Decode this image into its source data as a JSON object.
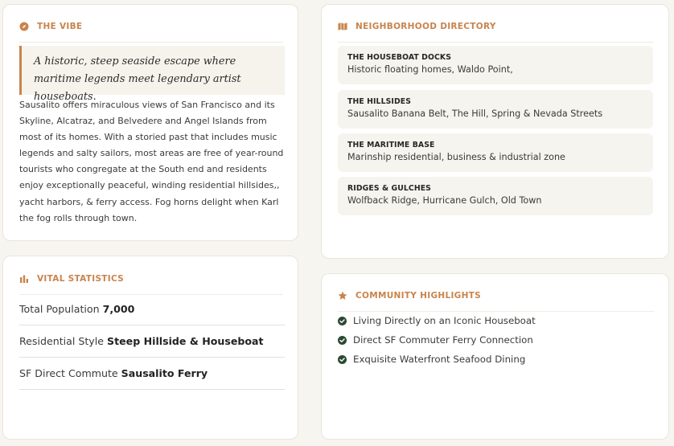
{
  "vibe": {
    "title": "The Vibe",
    "quote": "A historic, steep seaside escape where maritime legends meet legendary artist houseboats.",
    "body": "Sausalito offers miraculous views of San Francisco and its Skyline, Alcatraz, and Belvedere and Angel Islands from most of its homes. With a storied past that includes music legends and salty sailors, most areas are free of year-round tourists who congregate at the South end and residents enjoy exceptionally peaceful, winding residential hillsides,, yacht harbors, & ferry access. Fog horns delight when Karl the fog rolls through town."
  },
  "stats": {
    "title": "Vital Statistics",
    "items": [
      {
        "label": "Total Population",
        "value": "7,000"
      },
      {
        "label": "Residential Style",
        "value": "Steep Hillside & Houseboat"
      },
      {
        "label": "SF Direct Commute",
        "value": "Sausalito Ferry"
      }
    ]
  },
  "directory": {
    "title": "Neighborhood Directory",
    "items": [
      {
        "name": "THE HOUSEBOAT DOCKS",
        "desc": "Historic floating homes, Waldo Point,"
      },
      {
        "name": "THE HILLSIDES",
        "desc": "Sausalito Banana Belt, The Hill, Spring & Nevada Streets"
      },
      {
        "name": "THE MARITIME BASE",
        "desc": "Marinship residential, business & industrial zone"
      },
      {
        "name": "RIDGES & GULCHES",
        "desc": "Wolfback Ridge, Hurricane Gulch, Old Town"
      }
    ]
  },
  "highlights": {
    "title": "Community Highlights",
    "items": [
      "Living Directly on an Iconic Houseboat",
      "Direct SF Commuter Ferry Connection",
      "Exquisite Waterfront Seafood Dining"
    ]
  },
  "colors": {
    "accent": "#c8844c",
    "check": "#2b4a34",
    "card": "#ffffff",
    "background": "#f7f5f0"
  },
  "icons": {
    "vibe": "compass-icon",
    "stats": "bar-chart-icon",
    "directory": "map-icon",
    "highlights": "star-icon",
    "check": "check-circle-icon"
  }
}
